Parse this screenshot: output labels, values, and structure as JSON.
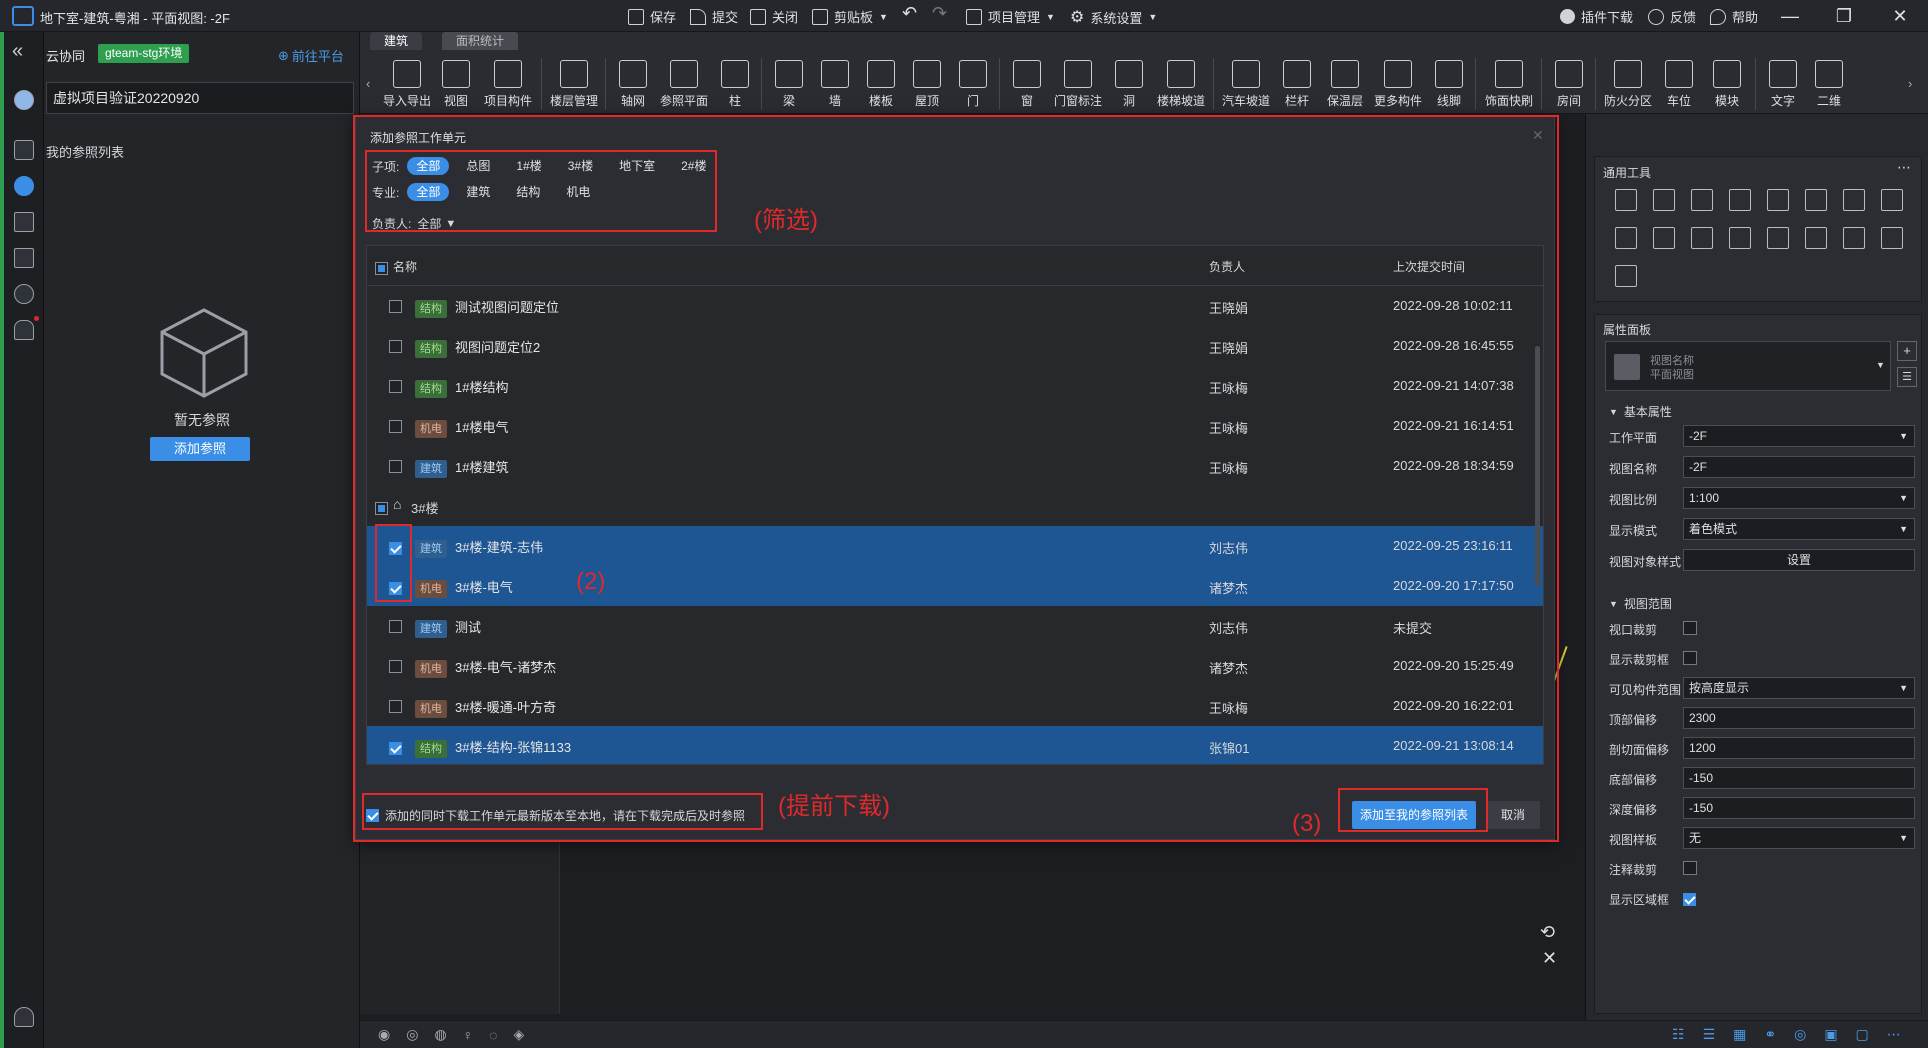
{
  "titlebar": {
    "title": "地下室-建筑-粤湘 - 平面视图: -2F",
    "commands": [
      "保存",
      "提交",
      "关闭",
      "剪贴板",
      "项目管理",
      "系统设置"
    ],
    "right_commands": [
      "插件下载",
      "反馈",
      "帮助"
    ]
  },
  "leftpanel": {
    "app_name": "云协同",
    "env_badge": "gteam-stg环境",
    "goto_platform": "前往平台",
    "project_name": "虚拟项目验证20220920",
    "my_ref_list": "我的参照列表",
    "empty_text": "暂无参照",
    "add_ref_button": "添加参照"
  },
  "ribbon": {
    "tabs": [
      "建筑",
      "面积统计"
    ],
    "buttons": [
      "导入导出",
      "视图",
      "项目构件",
      "楼层管理",
      "轴网",
      "参照平面",
      "柱",
      "梁",
      "墙",
      "楼板",
      "屋顶",
      "门",
      "窗",
      "门窗标注",
      "洞",
      "楼梯坡道",
      "汽车坡道",
      "栏杆",
      "保温层",
      "更多构件",
      "线脚",
      "饰面快刷",
      "房间",
      "防火分区",
      "车位",
      "模块",
      "文字",
      "二维"
    ]
  },
  "rightpanel": {
    "tools_title": "通用工具",
    "props_title": "属性面板",
    "view_type_name": "视图名称",
    "view_type_sub": "平面视图",
    "basic_section": "基本属性",
    "range_section": "视图范围",
    "props": [
      {
        "label": "工作平面",
        "value": "-2F",
        "kind": "select"
      },
      {
        "label": "视图名称",
        "value": "-2F",
        "kind": "input"
      },
      {
        "label": "视图比例",
        "value": "1:100",
        "kind": "select"
      },
      {
        "label": "显示模式",
        "value": "着色模式",
        "kind": "select"
      },
      {
        "label": "视图对象样式",
        "value": "设置",
        "kind": "button"
      }
    ],
    "range_props": [
      {
        "label": "视口裁剪",
        "kind": "check",
        "checked": false
      },
      {
        "label": "显示裁剪框",
        "kind": "check",
        "checked": false
      },
      {
        "label": "可见构件范围",
        "value": "按高度显示",
        "kind": "select"
      },
      {
        "label": "顶部偏移",
        "value": "2300",
        "kind": "input"
      },
      {
        "label": "剖切面偏移",
        "value": "1200",
        "kind": "input"
      },
      {
        "label": "底部偏移",
        "value": "-150",
        "kind": "input"
      },
      {
        "label": "深度偏移",
        "value": "-150",
        "kind": "input"
      },
      {
        "label": "视图样板",
        "value": "无",
        "kind": "select"
      },
      {
        "label": "注释裁剪",
        "kind": "check",
        "checked": false
      },
      {
        "label": "显示区域框",
        "kind": "check",
        "checked": true
      }
    ]
  },
  "dialog": {
    "title": "添加参照工作单元",
    "filter": {
      "sub_label": "子项:",
      "sub_items": [
        "全部",
        "总图",
        "1#楼",
        "3#楼",
        "地下室",
        "2#楼"
      ],
      "spec_label": "专业:",
      "spec_items": [
        "全部",
        "建筑",
        "结构",
        "机电"
      ],
      "owner_label": "负责人:",
      "owner_value": "全部"
    },
    "columns": {
      "name": "名称",
      "owner": "负责人",
      "time": "上次提交时间"
    },
    "group_name": "3#楼",
    "rows": [
      {
        "tag": "结构",
        "name": "测试视图问题定位",
        "owner": "王晓娟",
        "time": "2022-09-28 10:02:11",
        "checked": false
      },
      {
        "tag": "结构",
        "name": "视图问题定位2",
        "owner": "王晓娟",
        "time": "2022-09-28 16:45:55",
        "checked": false
      },
      {
        "tag": "结构",
        "name": "1#楼结构",
        "owner": "王咏梅",
        "time": "2022-09-21 14:07:38",
        "checked": false
      },
      {
        "tag": "机电",
        "name": "1#楼电气",
        "owner": "王咏梅",
        "time": "2022-09-21 16:14:51",
        "checked": false
      },
      {
        "tag": "建筑",
        "name": "1#楼建筑",
        "owner": "王咏梅",
        "time": "2022-09-28 18:34:59",
        "checked": false
      },
      {
        "tag": "建筑",
        "name": "3#楼-建筑-志伟",
        "owner": "刘志伟",
        "time": "2022-09-25 23:16:11",
        "checked": true
      },
      {
        "tag": "机电",
        "name": "3#楼-电气",
        "owner": "诸梦杰",
        "time": "2022-09-20 17:17:50",
        "checked": true
      },
      {
        "tag": "建筑",
        "name": "测试",
        "owner": "刘志伟",
        "time": "未提交",
        "checked": false
      },
      {
        "tag": "机电",
        "name": "3#楼-电气-诸梦杰",
        "owner": "诸梦杰",
        "time": "2022-09-20 15:25:49",
        "checked": false
      },
      {
        "tag": "机电",
        "name": "3#楼-暖通-叶方奇",
        "owner": "王咏梅",
        "time": "2022-09-20 16:22:01",
        "checked": false
      },
      {
        "tag": "结构",
        "name": "3#楼-结构-张锦1133",
        "owner": "张锦01",
        "time": "2022-09-21 13:08:14",
        "checked": true
      }
    ],
    "download_option": "添加的同时下载工作单元最新版本至本地，请在下载完成后及时参照",
    "confirm_button": "添加至我的参照列表",
    "cancel_button": "取消"
  },
  "annotations": {
    "filter": "(筛选)",
    "step2": "(2)",
    "predownload": "(提前下载)",
    "step3": "(3)"
  },
  "colors": {
    "accent": "#3a8ee6",
    "annotation_red": "#e0292b",
    "selected_row": "#1e5593",
    "env_badge": "#2e9e4f"
  }
}
